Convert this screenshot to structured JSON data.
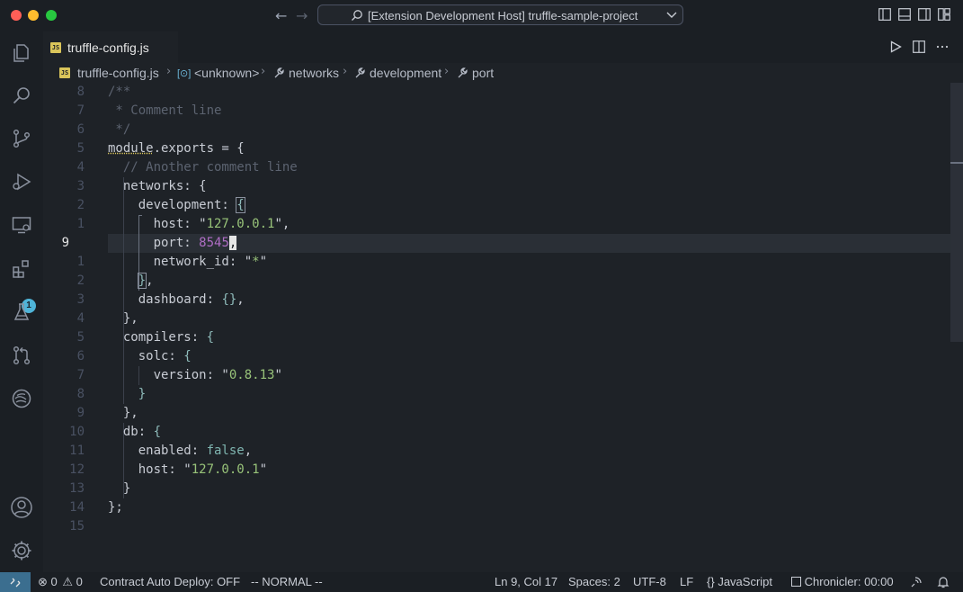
{
  "window": {
    "title": "[Extension Development Host] truffle-sample-project",
    "traffic_lights": {
      "close": "#ff5f57",
      "minimize": "#febc2e",
      "zoom": "#28c840"
    }
  },
  "activity_bar": {
    "icons": [
      "files-icon",
      "search-icon",
      "source-control-icon",
      "run-debug-icon",
      "remote-explorer-icon",
      "extensions-icon",
      "testing-icon",
      "pull-request-icon",
      "timeline-icon",
      "account-icon",
      "settings-gear-icon"
    ],
    "extensions_badge": "1"
  },
  "tab": {
    "label": "truffle-config.js",
    "icon_text": "JS"
  },
  "breadcrumb": {
    "file": "truffle-config.js",
    "items": [
      "<unknown>",
      "networks",
      "development",
      "port"
    ]
  },
  "editor": {
    "line_numbers": [
      "8",
      "7",
      "6",
      "5",
      "4",
      "3",
      "2",
      "1",
      "9",
      "1",
      "2",
      "3",
      "4",
      "5",
      "6",
      "7",
      "8",
      "9",
      "10",
      "11",
      "12",
      "13",
      "14",
      "15"
    ],
    "active_line_index": 8
  },
  "code": {
    "l0": "/**",
    "l1": " * Comment line",
    "l2": " */",
    "l3_a": "module",
    "l3_b": ".exports = {",
    "l4": "  // Another comment line",
    "l5": "  networks: {",
    "l6_a": "    development: ",
    "l6_b": "{",
    "l7_a": "      host: \"",
    "l7_s": "127.0.0.1",
    "l7_b": "\",",
    "l8_a": "      port: ",
    "l8_n": "8545",
    "l8_b": ",",
    "l9_a": "      network_id: \"",
    "l9_s": "*",
    "l9_b": "\"",
    "l10_a": "    ",
    "l10_br": "}",
    "l10_b": ",",
    "l11_a": "    dashboard: ",
    "l11_br": "{}",
    "l11_b": ",",
    "l12": "  },",
    "l13_a": "  compilers: ",
    "l13_br": "{",
    "l14_a": "    solc: ",
    "l14_br": "{",
    "l15_a": "      version: \"",
    "l15_s": "0.8.13",
    "l15_b": "\"",
    "l16": "    }",
    "l17": "  },",
    "l18_a": "  db: ",
    "l18_br": "{",
    "l19_a": "    enabled: ",
    "l19_v": "false",
    "l19_b": ",",
    "l20_a": "    host: \"",
    "l20_s": "127.0.0.1",
    "l20_b": "\"",
    "l21": "  }",
    "l22": "};"
  },
  "status": {
    "errors": "0",
    "warnings": "0",
    "contract_auto_deploy": "Contract Auto Deploy: OFF",
    "vim_mode": "-- NORMAL --",
    "cursor": "Ln 9, Col 17",
    "spaces": "Spaces: 2",
    "encoding": "UTF-8",
    "eol": "LF",
    "language": "JavaScript",
    "chronicler": "Chronicler: 00:00"
  },
  "colors": {
    "accent": "#4fb4d8",
    "background": "#1e2227",
    "string": "#98c379",
    "number": "#c678dd"
  }
}
